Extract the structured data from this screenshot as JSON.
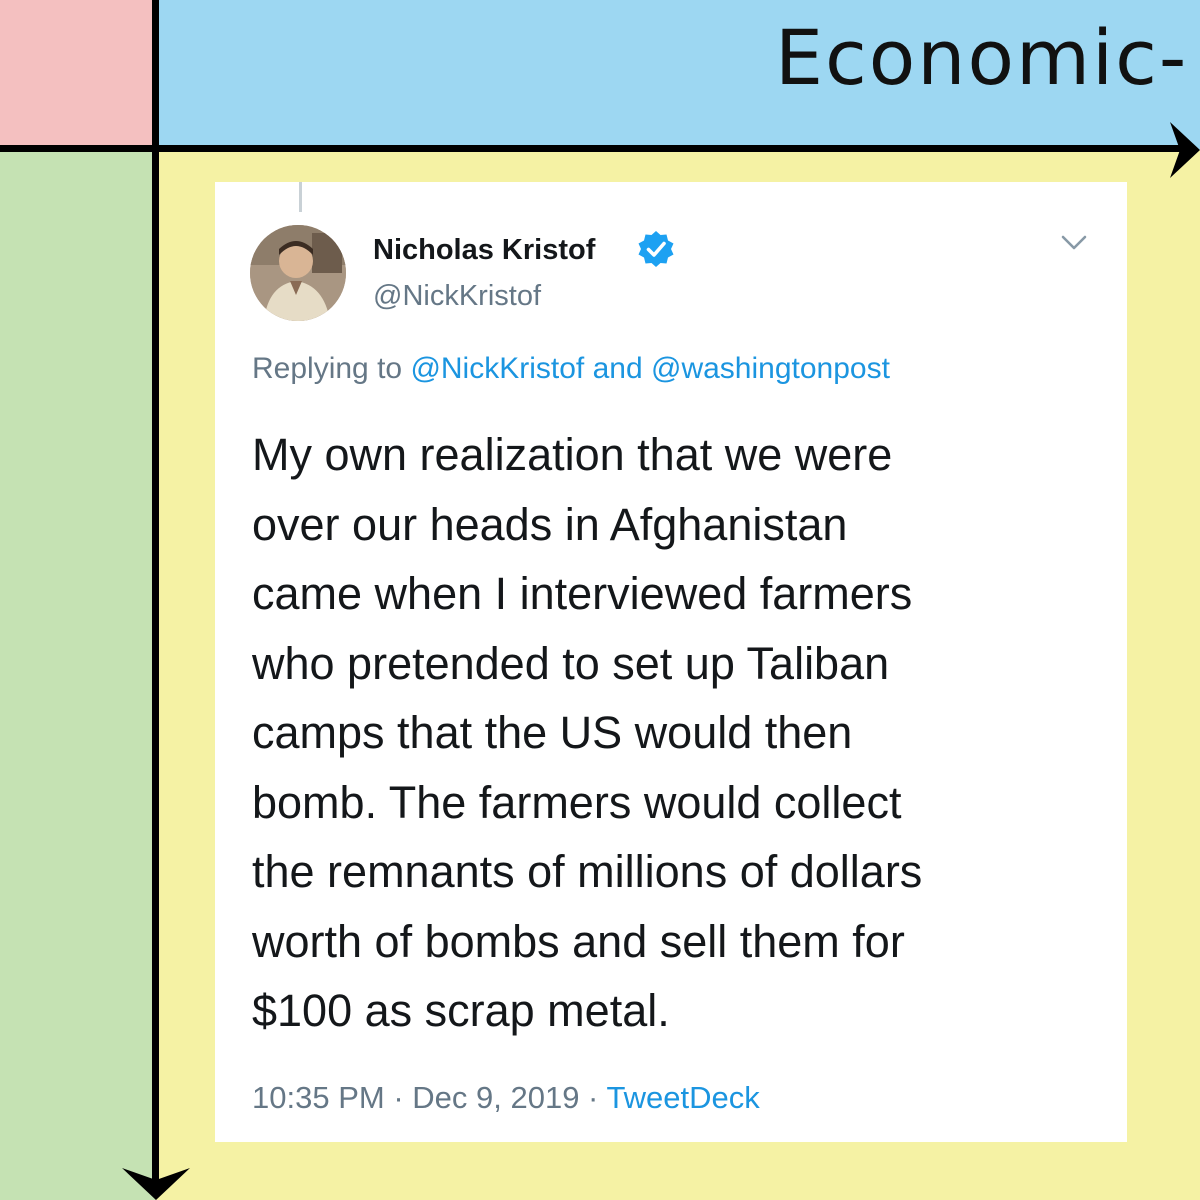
{
  "chart": {
    "x_axis_label": "Economic-"
  },
  "tweet": {
    "author_name": "Nicholas Kristof",
    "author_handle": "@NickKristof",
    "reply_prefix": "Replying to ",
    "reply_to_1": "@NickKristof",
    "reply_and": " and ",
    "reply_to_2": "@washingtonpost",
    "body": "My own realization that we were\nover our heads in Afghanistan\ncame when I interviewed farmers\nwho pretended to set up Taliban\ncamps that the US would then\nbomb. The farmers would collect\nthe remnants of millions of dollars\nworth of bombs and sell them for\n$100 as scrap metal.",
    "time": "10:35 PM",
    "separator": " · ",
    "date": "Dec 9, 2019",
    "source": "TweetDeck"
  },
  "colors": {
    "quadrant_top_left": "#f4c0c0",
    "quadrant_top_right": "#9dd7f2",
    "quadrant_bottom_left": "#c5e2b3",
    "quadrant_bottom_right": "#f5f2a4",
    "link_blue": "#1b95e0",
    "verified_blue": "#1da1f2"
  },
  "icons": [
    "verified-badge-icon",
    "chevron-down-icon",
    "arrow-right-icon",
    "arrow-down-icon"
  ]
}
